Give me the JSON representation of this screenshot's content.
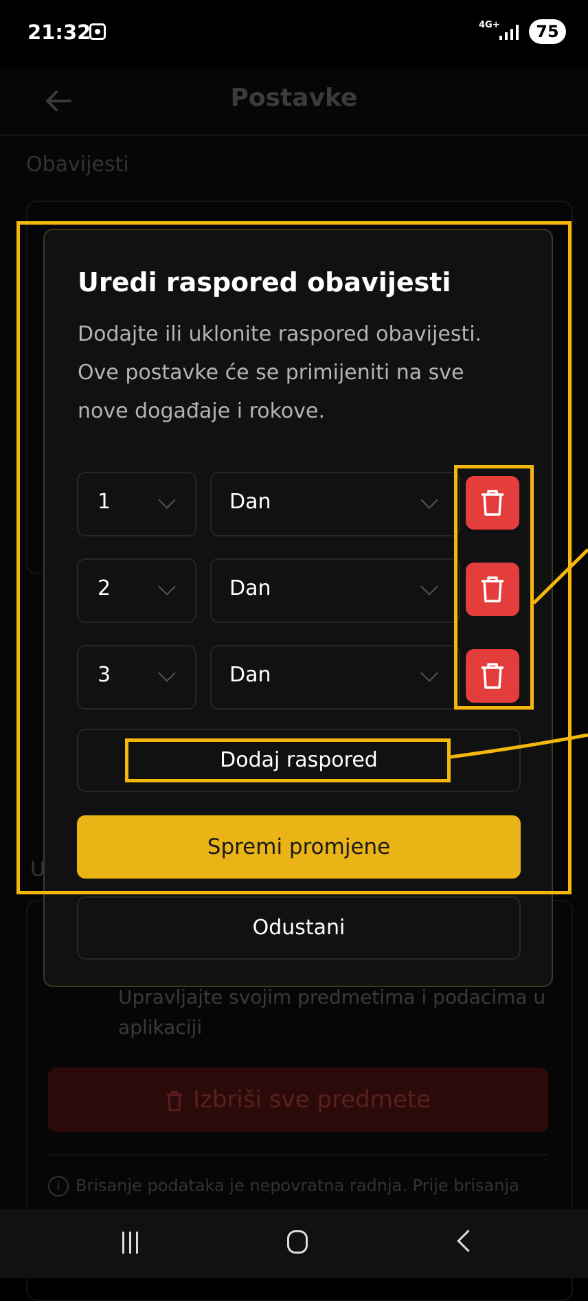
{
  "status_bar": {
    "time": "21:32",
    "network": "4G+",
    "battery": "75"
  },
  "app": {
    "title": "Postavke",
    "section_notifications": "Obavijesti",
    "section_second_partial": "U",
    "subjects_description": "Upravljajte svojim predmetima i podacima u aplikaciji",
    "delete_all_label": "Izbriši sve predmete",
    "note_text": "Brisanje podataka je nepovratna radnja. Prije brisanja"
  },
  "dialog": {
    "title": "Uredi raspored obavijesti",
    "description": "Dodajte ili uklonite raspored obavijesti. Ove postavke će se primijeniti na sve nove događaje i rokove.",
    "rows": [
      {
        "number": "1",
        "unit": "Dan"
      },
      {
        "number": "2",
        "unit": "Dan"
      },
      {
        "number": "3",
        "unit": "Dan"
      }
    ],
    "add_label": "Dodaj raspored",
    "save_label": "Spremi promjene",
    "cancel_label": "Odustani"
  },
  "colors": {
    "accent": "#eab417",
    "danger": "#e33e3b",
    "highlight": "#f5b70c"
  }
}
